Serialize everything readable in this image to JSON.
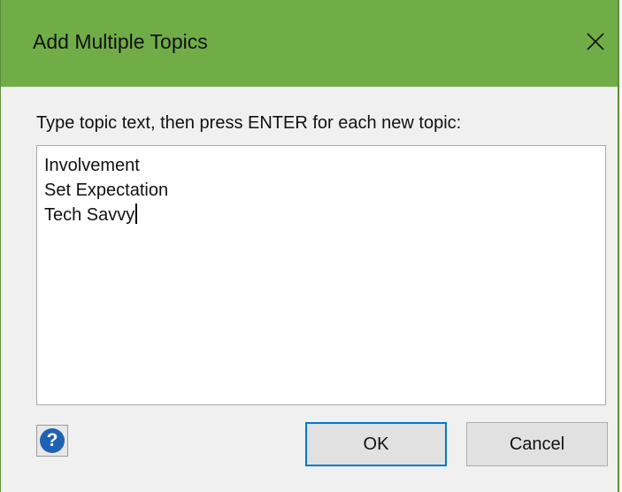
{
  "dialog": {
    "title": "Add Multiple Topics",
    "close_icon": "close-icon",
    "instruction": "Type topic text, then press ENTER for each new topic:",
    "topics": [
      "Involvement",
      "Set Expectation",
      "Tech Savvy"
    ],
    "help_icon": "help-icon",
    "help_glyph": "?",
    "ok_label": "OK",
    "cancel_label": "Cancel"
  },
  "colors": {
    "title_bar": "#70ad47",
    "dialog_bg": "#f0f0f0",
    "focus_border": "#0078d7",
    "help_icon": "#1f62b4"
  }
}
